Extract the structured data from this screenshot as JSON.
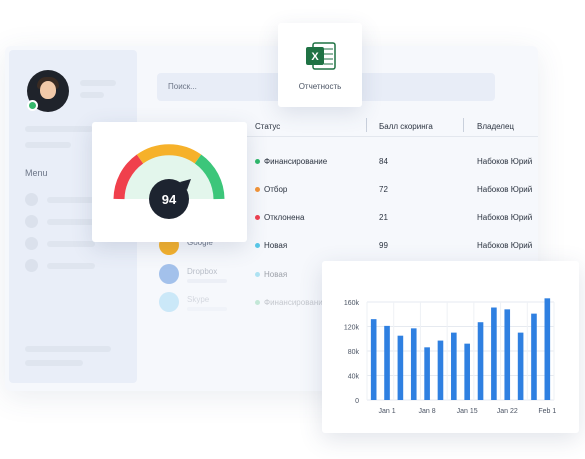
{
  "search": {
    "placeholder": "Поиск..."
  },
  "sidebar": {
    "menu_label": "Menu"
  },
  "excel": {
    "label": "Отчетность",
    "icon": "excel-icon",
    "color": "#1f7244"
  },
  "gauge": {
    "value": "94",
    "colors": {
      "red": "#f0404c",
      "orange": "#f6b12a",
      "green": "#3cc67a",
      "needle": "#1d2430",
      "fill": "#e3f6ec"
    }
  },
  "table": {
    "headers": {
      "status": "Статус",
      "score": "Балл скоринга",
      "owner": "Владелец"
    },
    "rows": [
      {
        "status": "Финансирование",
        "status_color": "#2fb86b",
        "score": "84",
        "owner": "Набоков Юрий"
      },
      {
        "status": "Отбор",
        "status_color": "#f39437",
        "score": "72",
        "owner": "Набоков Юрий"
      },
      {
        "status": "Отклонена",
        "status_color": "#ef3f4f",
        "score": "21",
        "owner": "Набоков Юрий"
      },
      {
        "status": "Новая",
        "status_color": "#59c8e8",
        "score": "99",
        "owner": "Набоков Юрий"
      },
      {
        "status": "Новая",
        "status_color": "#59c8e8",
        "score": "",
        "owner": ""
      },
      {
        "status": "Финансирование",
        "status_color": "#2fb86b",
        "score": "",
        "owner": ""
      }
    ]
  },
  "companies": [
    {
      "name": "Google",
      "color": "#f6b12a"
    },
    {
      "name": "Dropbox",
      "color": "#3f7fd8"
    },
    {
      "name": "Skype",
      "color": "#4cb6ec"
    }
  ],
  "chart_data": {
    "type": "bar",
    "x_tick_labels": [
      "Jan 1",
      "Jan 8",
      "Jan 15",
      "Jan 22",
      "Feb 1"
    ],
    "y_tick_labels": [
      "0",
      "40k",
      "80k",
      "120k",
      "160k"
    ],
    "values": [
      132000,
      121000,
      105000,
      117000,
      86000,
      97000,
      110000,
      92000,
      127000,
      151000,
      148000,
      110000,
      141000,
      166000
    ],
    "ylim": [
      0,
      160000
    ],
    "grid": true,
    "bar_color": "#2f80e1"
  }
}
